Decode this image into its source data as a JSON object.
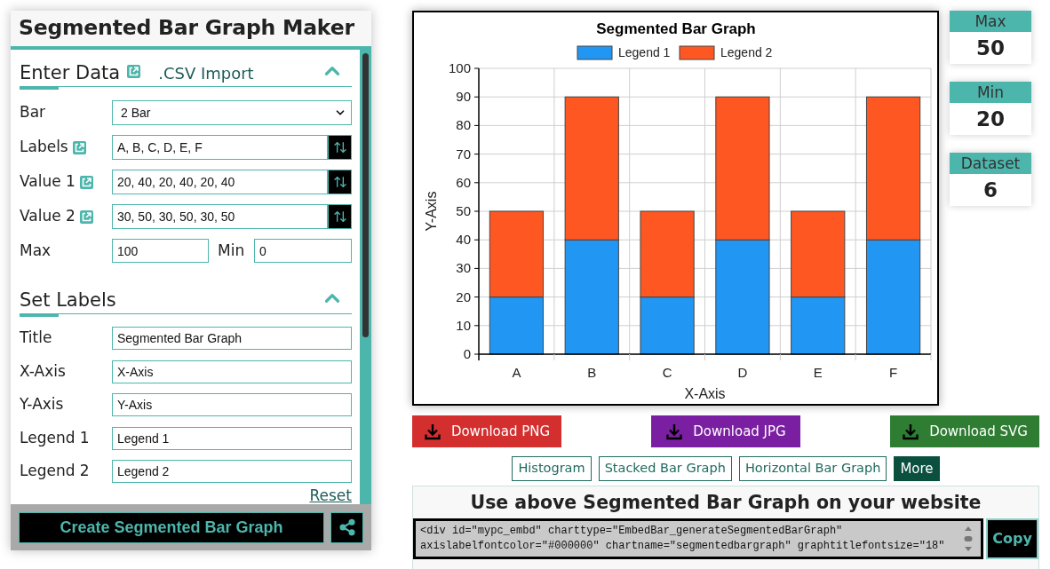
{
  "left_panel": {
    "title": "Segmented Bar Graph Maker",
    "enter_data": {
      "heading": "Enter Data",
      "csv_import": ".CSV Import",
      "expanded": true,
      "bar": {
        "label": "Bar",
        "value": "2 Bar"
      },
      "series_inputs": [
        {
          "label": "Labels",
          "value": "A, B, C, D, E, F"
        },
        {
          "label": "Value 1",
          "value": "20, 40, 20, 40, 20, 40"
        },
        {
          "label": "Value 2",
          "value": "30, 50, 30, 50, 30, 50"
        }
      ],
      "max": {
        "label": "Max",
        "value": "100"
      },
      "min": {
        "label": "Min",
        "value": "0"
      }
    },
    "set_labels": {
      "heading": "Set Labels",
      "expanded": true,
      "fields": [
        {
          "label": "Title",
          "value": "Segmented Bar Graph"
        },
        {
          "label": "X-Axis",
          "value": "X-Axis"
        },
        {
          "label": "Y-Axis",
          "value": "Y-Axis"
        },
        {
          "label": "Legend 1",
          "value": "Legend 1"
        },
        {
          "label": "Legend 2",
          "value": "Legend 2"
        }
      ]
    },
    "reset": "Reset",
    "create_button": "Create Segmented Bar Graph"
  },
  "chart": {
    "chart_data": {
      "type": "bar",
      "stacked": true,
      "title": "Segmented Bar Graph",
      "xlabel": "X-Axis",
      "ylabel": "Y-Axis",
      "categories": [
        "A",
        "B",
        "C",
        "D",
        "E",
        "F"
      ],
      "series": [
        {
          "name": "Legend 1",
          "color": "#2196f3",
          "values": [
            20,
            40,
            20,
            40,
            20,
            40
          ]
        },
        {
          "name": "Legend 2",
          "color": "#ff5722",
          "values": [
            30,
            50,
            30,
            50,
            30,
            50
          ]
        }
      ],
      "ylim": [
        0,
        100
      ],
      "yticks": [
        0,
        10,
        20,
        30,
        40,
        50,
        60,
        70,
        80,
        90,
        100
      ],
      "grid": true,
      "legend": "top"
    }
  },
  "stats": [
    {
      "label": "Max",
      "value": "50"
    },
    {
      "label": "Min",
      "value": "20"
    },
    {
      "label": "Dataset",
      "value": "6"
    }
  ],
  "downloads": [
    {
      "label": "Download PNG",
      "color": "#d32f2f"
    },
    {
      "label": "Download JPG",
      "color": "#7b1fa2"
    },
    {
      "label": "Download SVG",
      "color": "#2e7d32"
    }
  ],
  "related_links": [
    {
      "label": "Histogram",
      "kind": "outline"
    },
    {
      "label": "Stacked Bar Graph",
      "kind": "outline"
    },
    {
      "label": "Horizontal Bar Graph",
      "kind": "outline"
    },
    {
      "label": "More",
      "kind": "filled"
    }
  ],
  "embed": {
    "heading": "Use above Segmented Bar Graph on your website",
    "code_lines": [
      "<div id=\"mypc_embd\" charttype=\"EmbedBar_generateSegmentedBarGraph\"",
      "axislabelfontcolor=\"#000000\" chartname=\"segmentedbargraph\" graphtitlefontsize=\"18\""
    ],
    "copy_button": "Copy"
  }
}
